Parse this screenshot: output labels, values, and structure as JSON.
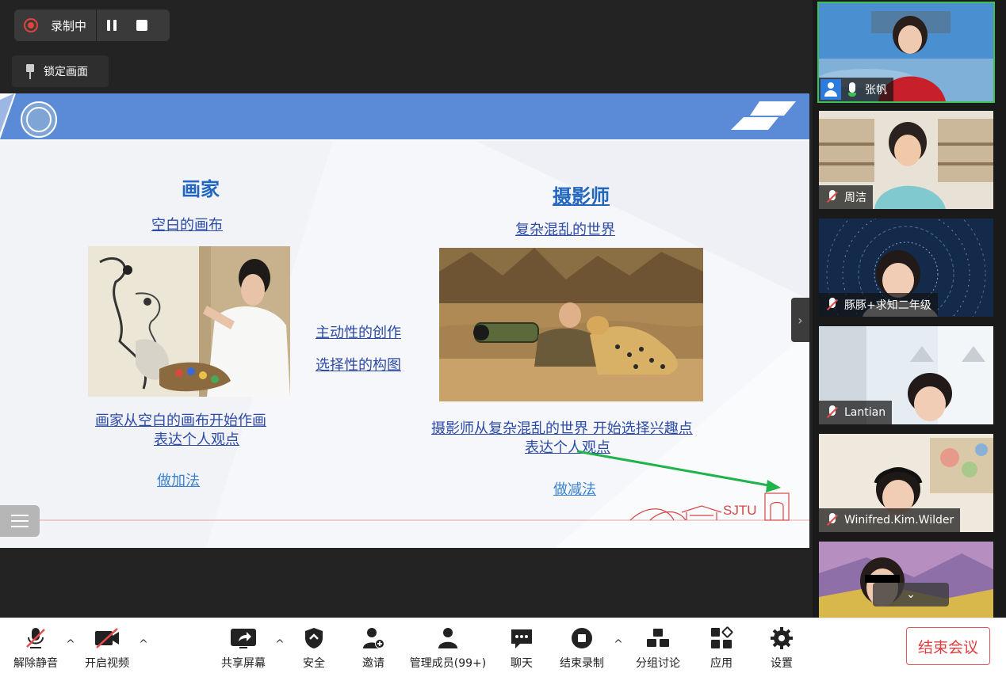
{
  "recording": {
    "label": "录制中"
  },
  "lock_view": {
    "label": "锁定画面"
  },
  "slide": {
    "left": {
      "heading": "画家",
      "subtitle": "空白的画布",
      "caption_line1": "画家从空白的画布开始作画",
      "caption_line2": "表达个人观点",
      "method": "做加法"
    },
    "middle": {
      "point1": "主动性的创作",
      "point2": "选择性的构图"
    },
    "right": {
      "heading": "摄影师",
      "subtitle": "复杂混乱的世界",
      "caption_line1": "摄影师从复杂混乱的世界 开始选择兴趣点",
      "caption_line2": "表达个人观点",
      "method": "做减法"
    },
    "footer_logo": "SJTU"
  },
  "participants": [
    {
      "name": "张帆",
      "mic": "on",
      "host": true
    },
    {
      "name": "周洁",
      "mic": "muted"
    },
    {
      "name": "豚豚+求知二年级",
      "mic": "muted"
    },
    {
      "name": "Lantian",
      "mic": "muted"
    },
    {
      "name": "Winifred.Kim.Wilder",
      "mic": "muted"
    },
    {
      "name": "",
      "mic": ""
    }
  ],
  "toolbar": {
    "unmute": "解除静音",
    "start_video": "开启视频",
    "share_screen": "共享屏幕",
    "security": "安全",
    "invite": "邀请",
    "manage_members": "管理成员(99+)",
    "chat": "聊天",
    "end_recording": "结束录制",
    "breakout": "分组讨论",
    "apps": "应用",
    "settings": "设置",
    "end_meeting": "结束会议"
  },
  "colors": {
    "accent_blue": "#5b8bd6",
    "end_red": "#e03e3e",
    "active_green": "#3fbf55"
  }
}
